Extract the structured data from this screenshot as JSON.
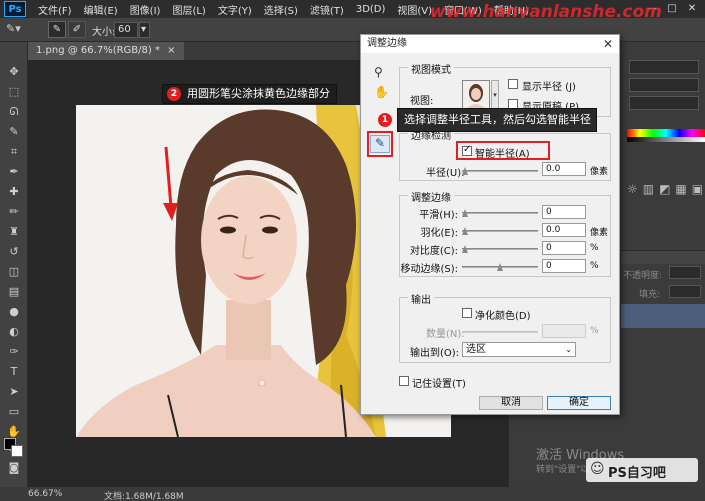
{
  "menubar": {
    "logo": "Ps",
    "items": [
      "文件(F)",
      "编辑(E)",
      "图像(I)",
      "图层(L)",
      "文字(Y)",
      "选择(S)",
      "滤镜(T)",
      "3D(D)",
      "视图(V)",
      "窗口(W)",
      "帮助(H)"
    ],
    "window_controls": [
      "—",
      "□",
      "✕"
    ]
  },
  "options": {
    "size_label": "大小:",
    "size_value": "60"
  },
  "document": {
    "tab_title": "1.png @ 66.7%(RGB/8) *",
    "tab_close": "×"
  },
  "status": {
    "zoom": "66.67%",
    "doc_info": "文档:1.68M/1.68M"
  },
  "callouts": {
    "step2_number": "2",
    "step2_text": "用圆形笔尖涂抹黄色边缘部分",
    "step1_number": "1",
    "step1_text": "选择调整半径工具，然后勾选智能半径"
  },
  "dialog": {
    "title": "调整边缘",
    "close": "✕",
    "view_mode": {
      "group_title": "视图模式",
      "view_label": "视图:",
      "show_radius_label": "显示半径 (J)",
      "show_original_label": "显示原稿 (P)"
    },
    "edge_detection": {
      "group_title": "边缘检测",
      "smart_radius_label": "智能半径(A)",
      "smart_radius_checked": true,
      "radius_label": "半径(U):",
      "radius_value": "0.0",
      "radius_unit": "像素",
      "radius_level": 0
    },
    "adjust_edge": {
      "group_title": "调整边缘",
      "rows": [
        {
          "label": "平滑(H):",
          "value": "0",
          "unit": "",
          "level": 0
        },
        {
          "label": "羽化(E):",
          "value": "0.0",
          "unit": "像素",
          "level": 0
        },
        {
          "label": "对比度(C):",
          "value": "0",
          "unit": "%",
          "level": 0
        },
        {
          "label": "移动边缘(S):",
          "value": "0",
          "unit": "%",
          "level": 0.5
        }
      ]
    },
    "output": {
      "group_title": "输出",
      "decontaminate_label": "净化颜色(D)",
      "amount_label": "数量(N):",
      "amount_unit": "%",
      "output_to_label": "输出到(O):",
      "output_to_value": "选区"
    },
    "remember_label": "记住设置(T)",
    "cancel_label": "取消",
    "ok_label": "确定"
  },
  "right_panel": {
    "opacity_label": "不透明度:",
    "fill_label": "填充:"
  },
  "watermarks": {
    "url": "www.hanyanlanshe.com",
    "activate": "激活 Windows",
    "activate_sub": "转到\"设置\"以激活Windows。",
    "brand": "PS自习吧"
  }
}
